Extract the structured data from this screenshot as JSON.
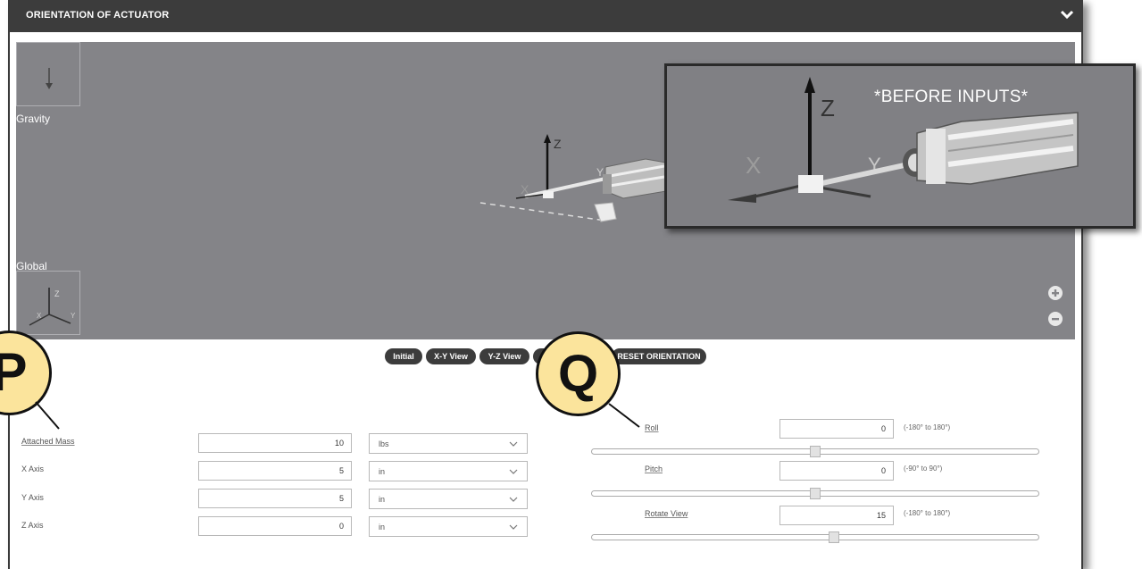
{
  "header": {
    "title": "ORIENTATION OF ACTUATOR"
  },
  "viewport": {
    "gravity_label": "Gravity",
    "global_label": "Global",
    "model_axis_z": "Z",
    "model_axis_x": "X",
    "model_axis_y": "Y"
  },
  "inset": {
    "title": "*BEFORE INPUTS*",
    "axis_z": "Z",
    "axis_x": "X",
    "axis_y": "Y"
  },
  "view_buttons": {
    "initial": "Initial",
    "xy": "X-Y View",
    "yz": "Y-Z View",
    "reset": "RESET ORIENTATION"
  },
  "callouts": {
    "left": "P",
    "right": "Q"
  },
  "mass_inputs": [
    {
      "label": "Attached Mass",
      "value": "10",
      "unit": "lbs"
    },
    {
      "label": "X Axis",
      "value": "5",
      "unit": "in"
    },
    {
      "label": "Y Axis",
      "value": "5",
      "unit": "in"
    },
    {
      "label": "Z Axis",
      "value": "0",
      "unit": "in"
    }
  ],
  "orientation": [
    {
      "label": "Roll",
      "value": "0",
      "range": "(-180° to 180°)",
      "slider_fraction": 0.5
    },
    {
      "label": "Pitch",
      "value": "0",
      "range": "(-90° to 90°)",
      "slider_fraction": 0.5
    },
    {
      "label": "Rotate View",
      "value": "15",
      "range": "(-180° to 180°)",
      "slider_fraction": 0.542
    }
  ],
  "colors": {
    "header": "#3c3c3c",
    "viewport": "#848488",
    "callout_fill": "#fbe49c"
  }
}
